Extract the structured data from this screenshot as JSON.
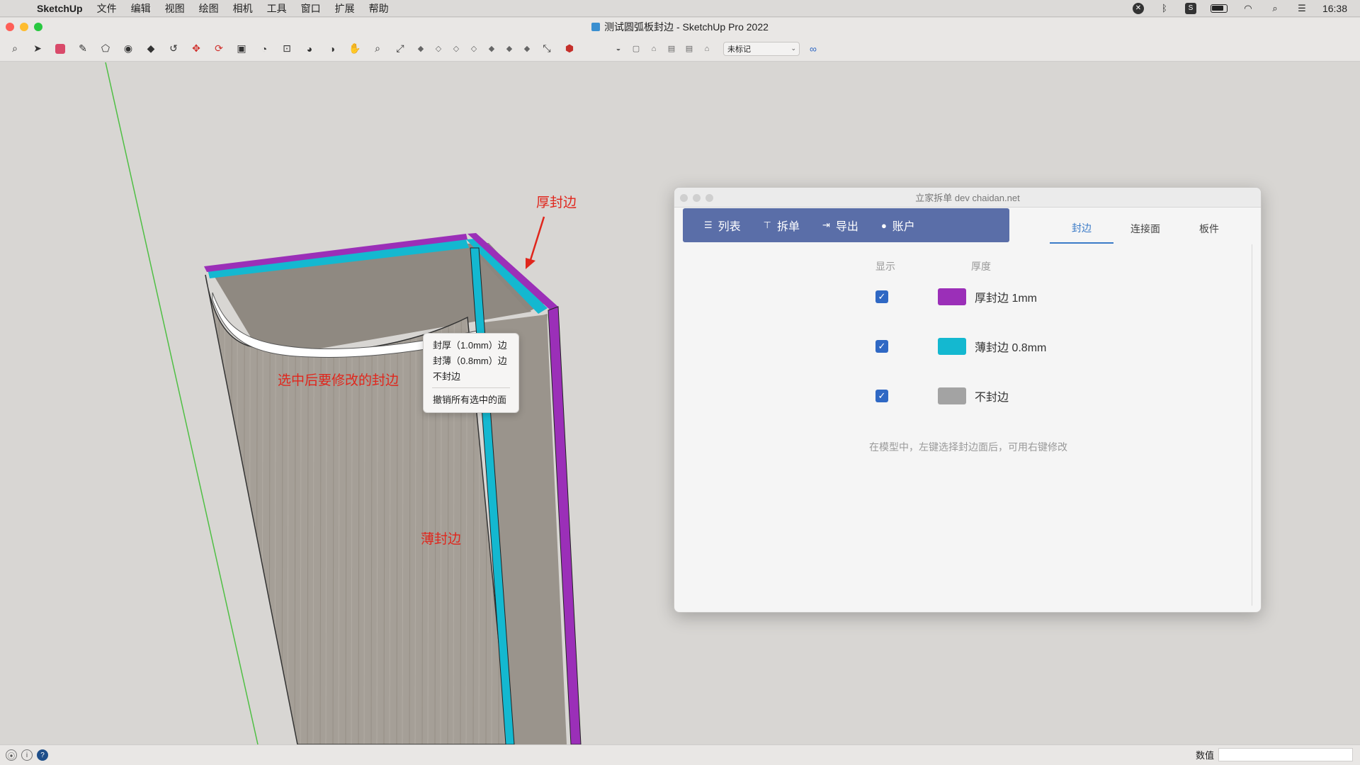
{
  "menubar": {
    "app_name": "SketchUp",
    "items": [
      "文件",
      "编辑",
      "视图",
      "绘图",
      "相机",
      "工具",
      "窗口",
      "扩展",
      "帮助"
    ],
    "clock": "16:38"
  },
  "window": {
    "title": "测试圆弧板封边 - SketchUp Pro 2022"
  },
  "toolbar": {
    "tag_select_value": "未标记"
  },
  "viewport": {
    "annotation_thick": "厚封边",
    "annotation_selected": "选中后要修改的封边",
    "annotation_thin": "薄封边",
    "context_menu": {
      "items": [
        "封厚（1.0mm）边",
        "封薄（0.8mm）边",
        "不封边"
      ],
      "after_separator": "撤销所有选中的面"
    }
  },
  "dialog": {
    "title": "立家拆单 dev  chaidan.net",
    "nav": {
      "list": "列表",
      "split": "拆单",
      "export": "导出",
      "account": "账户"
    },
    "tabs": [
      "封边",
      "连接面",
      "板件"
    ],
    "active_tab": "封边",
    "col_show": "显示",
    "col_thickness": "厚度",
    "rows": [
      {
        "label": "厚封边 1mm",
        "color": "#9b2fb8",
        "checked": true
      },
      {
        "label": "薄封边 0.8mm",
        "color": "#14b8d0",
        "checked": true
      },
      {
        "label": "不封边",
        "color": "#a3a3a3",
        "checked": true
      }
    ],
    "hint": "在模型中，左键选择封边面后，可用右键修改"
  },
  "statusbar": {
    "measure_label": "数值"
  }
}
